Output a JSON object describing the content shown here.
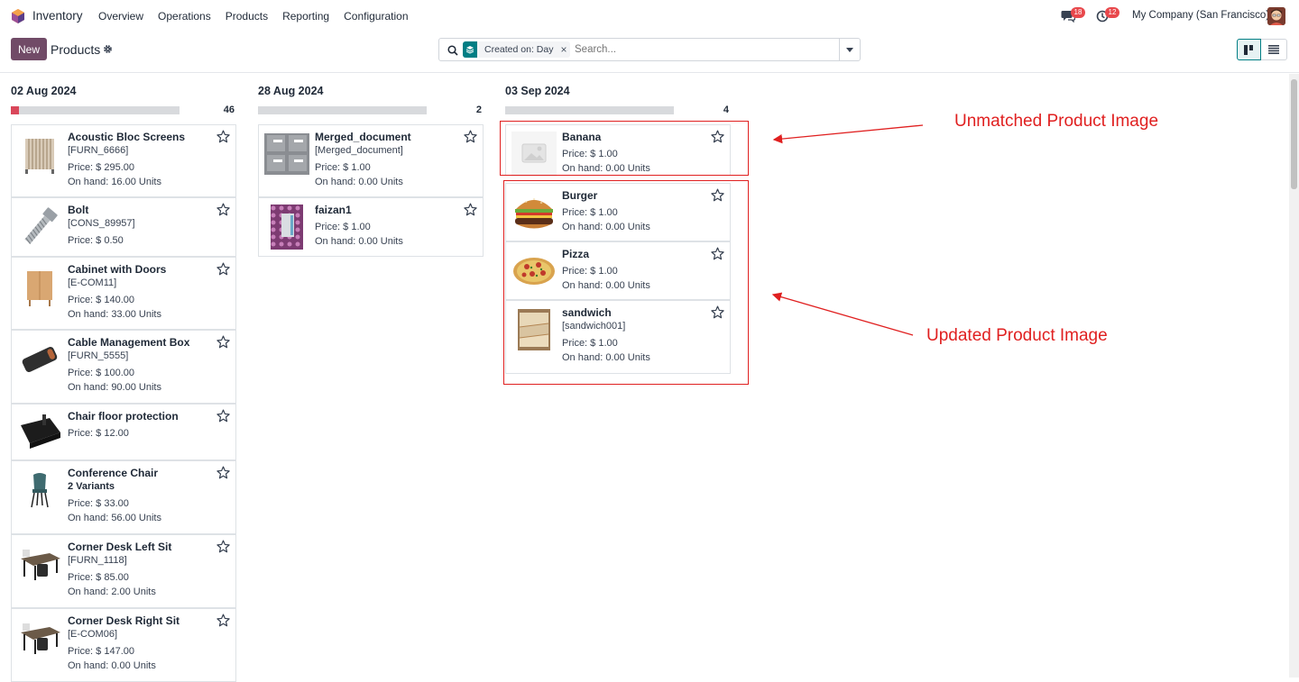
{
  "navbar": {
    "app_name": "Inventory",
    "menu": [
      "Overview",
      "Operations",
      "Products",
      "Reporting",
      "Configuration"
    ],
    "messages_badge": "18",
    "activity_badge": "12",
    "company": "My Company (San Francisco)"
  },
  "control_panel": {
    "new_label": "New",
    "title": "Products",
    "facet": "Created on: Day",
    "search_placeholder": "Search..."
  },
  "columns": [
    {
      "title": "02 Aug 2024",
      "count": "46",
      "progress_fraction": 0.05,
      "cards": [
        {
          "name": "Acoustic Bloc Screens",
          "ref": "[FURN_6666]",
          "price": "Price: $ 295.00",
          "onhand": "On hand: 16.00 Units",
          "icon": "acoustic-screen-image"
        },
        {
          "name": "Bolt",
          "ref": "[CONS_89957]",
          "price": "Price: $ 0.50",
          "onhand": "",
          "icon": "bolt-image"
        },
        {
          "name": "Cabinet with Doors",
          "ref": "[E-COM11]",
          "price": "Price: $ 140.00",
          "onhand": "On hand: 33.00 Units",
          "icon": "cabinet-image"
        },
        {
          "name": "Cable Management Box",
          "ref": "[FURN_5555]",
          "price": "Price: $ 100.00",
          "onhand": "On hand: 90.00 Units",
          "icon": "cable-box-image"
        },
        {
          "name": "Chair floor protection",
          "ref": "",
          "price": "Price: $ 12.00",
          "onhand": "",
          "icon": "floor-protection-image"
        },
        {
          "name": "Conference Chair",
          "ref": "2 Variants",
          "price": "Price: $ 33.00",
          "onhand": "On hand: 56.00 Units",
          "icon": "chair-image"
        },
        {
          "name": "Corner Desk Left Sit",
          "ref": "[FURN_1118]",
          "price": "Price: $ 85.00",
          "onhand": "On hand: 2.00 Units",
          "icon": "desk-image"
        },
        {
          "name": "Corner Desk Right Sit",
          "ref": "[E-COM06]",
          "price": "Price: $ 147.00",
          "onhand": "On hand: 0.00 Units",
          "icon": "desk-image"
        }
      ]
    },
    {
      "title": "28 Aug 2024",
      "count": "2",
      "progress_fraction": 0,
      "cards": [
        {
          "name": "Merged_document",
          "ref": "[Merged_document]",
          "price": "Price: $ 1.00",
          "onhand": "On hand: 0.00 Units",
          "icon": "document-image"
        },
        {
          "name": "faizan1",
          "ref": "",
          "price": "Price: $ 1.00",
          "onhand": "On hand: 0.00 Units",
          "icon": "pattern-image"
        }
      ]
    },
    {
      "title": "03 Sep 2024",
      "count": "4",
      "progress_fraction": 0,
      "cards": [
        {
          "name": "Banana",
          "ref": "",
          "price": "Price: $ 1.00",
          "onhand": "On hand: 0.00 Units",
          "icon": "placeholder-image"
        },
        {
          "name": "Burger",
          "ref": "",
          "price": "Price: $ 1.00",
          "onhand": "On hand: 0.00 Units",
          "icon": "burger-image"
        },
        {
          "name": "Pizza",
          "ref": "",
          "price": "Price: $ 1.00",
          "onhand": "On hand: 0.00 Units",
          "icon": "pizza-image"
        },
        {
          "name": "sandwich",
          "ref": "[sandwich001]",
          "price": "Price: $ 1.00",
          "onhand": "On hand: 0.00 Units",
          "icon": "sandwich-image"
        }
      ]
    }
  ],
  "annotations": {
    "unmatched": "Unmatched Product Image",
    "updated": "Updated Product Image",
    "color": "#e02020"
  }
}
